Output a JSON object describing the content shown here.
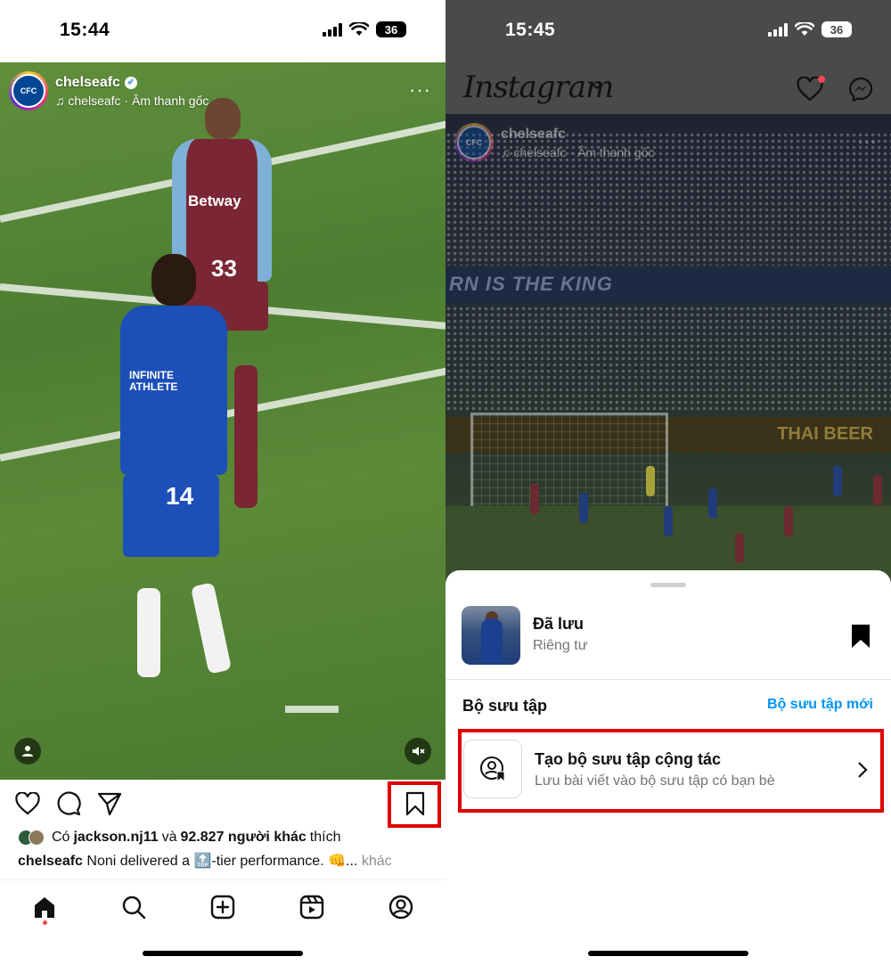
{
  "left": {
    "status_time": "15:44",
    "battery": "36",
    "post": {
      "username": "chelseafc",
      "audio": "chelseafc · Âm thanh gốc",
      "more": "···",
      "player_front_number": "14",
      "player_back_number": "33",
      "shirt_sponsor_front": "INFINITE ATHLETE",
      "shirt_sponsor_back": "Betway",
      "likes_prefix": "Có",
      "likes_user": "jackson.nj11",
      "likes_and": "và",
      "likes_count": "92.827 người khác",
      "likes_suffix": "thích",
      "caption_user": "chelseafc",
      "caption_text": "Noni delivered a 🔝-tier performance. 👊",
      "caption_more_ellipsis": "...",
      "caption_more": "khác"
    },
    "icons": [
      "heart-icon",
      "comment-icon",
      "share-icon",
      "bookmark-icon",
      "home-icon",
      "search-icon",
      "new-post-icon",
      "reels-icon",
      "profile-icon"
    ]
  },
  "right": {
    "status_time": "15:45",
    "battery": "36",
    "app_title": "Instagram",
    "bg_post": {
      "username": "chelseafc",
      "audio": "chelseafc · Âm thanh gốc",
      "banner_text": "RN IS THE KING",
      "ad_text": "THAI BEER"
    },
    "sheet": {
      "saved_title": "Đã lưu",
      "saved_sub": "Riêng tư",
      "collections_label": "Bộ sưu tập",
      "new_collection": "Bộ sưu tập mới",
      "collab_title": "Tạo bộ sưu tập cộng tác",
      "collab_sub": "Lưu bài viết vào bộ sưu tập có bạn bè"
    }
  },
  "colors": {
    "highlight": "#e00000",
    "link_blue": "#0095f6",
    "notification": "#ed4956",
    "chelsea_blue": "#034694"
  }
}
